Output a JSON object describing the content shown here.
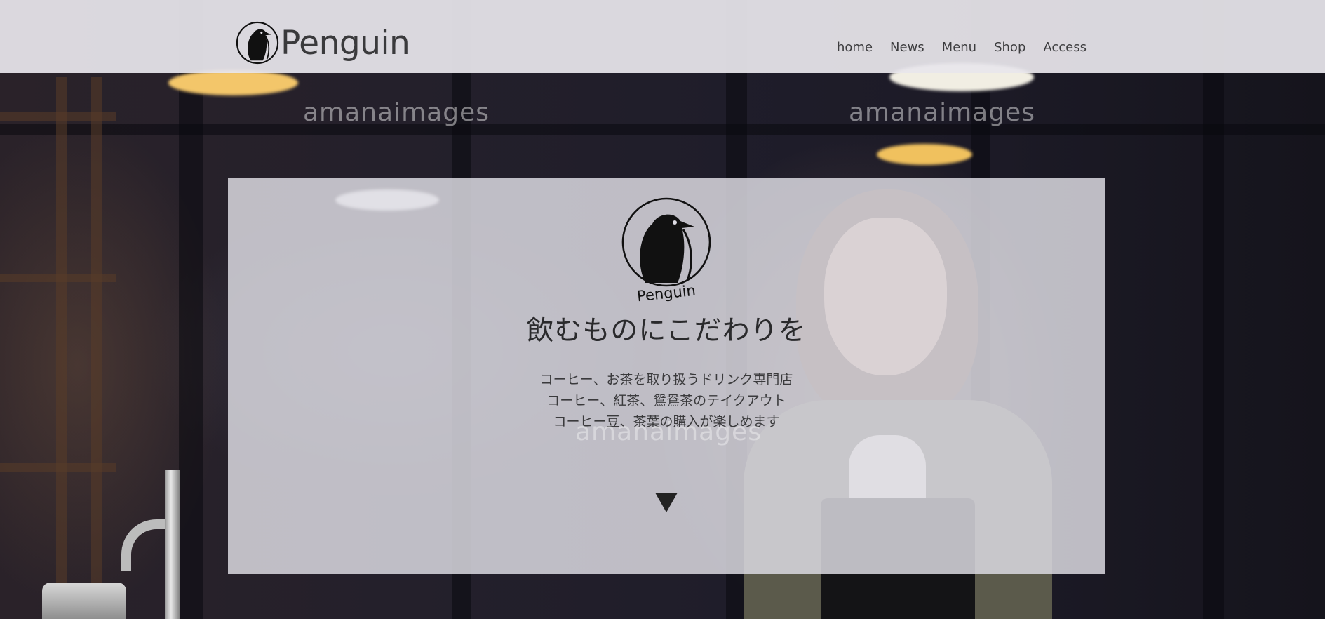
{
  "header": {
    "brand_name": "Penguin",
    "logo_icon": "penguin-logo-icon",
    "nav": [
      {
        "label": "home"
      },
      {
        "label": "News"
      },
      {
        "label": "Menu"
      },
      {
        "label": "Shop"
      },
      {
        "label": "Access"
      }
    ]
  },
  "background": {
    "watermarks": [
      "amanaimages",
      "amanaimages",
      "amanaimages"
    ]
  },
  "hero": {
    "logo_icon": "penguin-emblem-icon",
    "logo_text": "Penguin",
    "title": "飲むものにこだわりを",
    "description": [
      "コーヒー、お茶を取り扱うドリンク専門店",
      "コーヒー、紅茶、鴛鴦茶のテイクアウト",
      "コーヒー豆、茶葉の購入が楽しめます"
    ],
    "scroll_icon": "triangle-down-icon"
  },
  "colors": {
    "header_bg": "#e8e6ec",
    "panel_bg": "#dedce4",
    "text_dark": "#2a2a2c"
  }
}
